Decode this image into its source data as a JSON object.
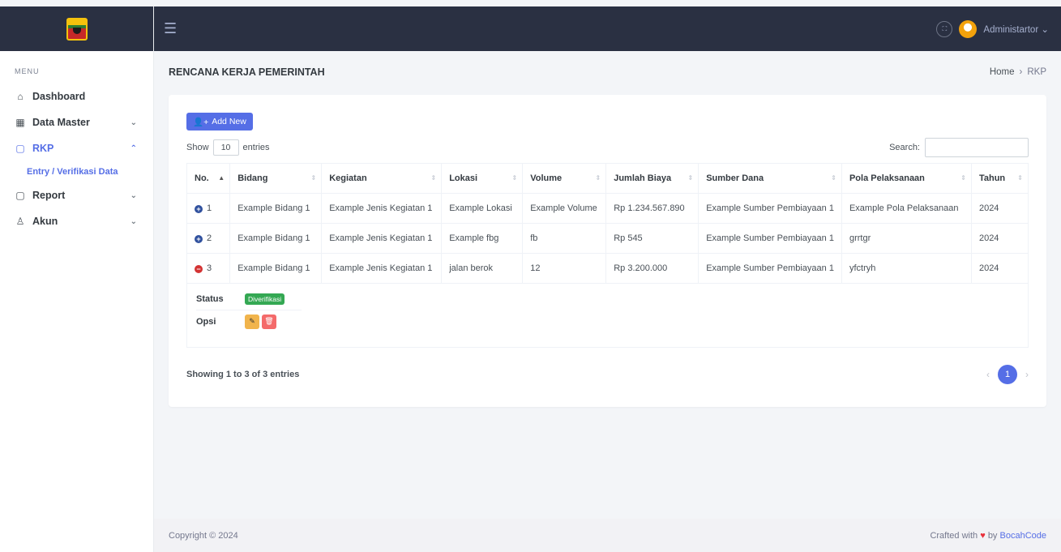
{
  "sidebar": {
    "menu_title": "MENU",
    "items": [
      {
        "label": "Dashboard",
        "icon": "home-icon"
      },
      {
        "label": "Data Master",
        "icon": "grid-icon"
      },
      {
        "label": "RKP",
        "icon": "file-icon"
      },
      {
        "label": "Report",
        "icon": "file-icon"
      },
      {
        "label": "Akun",
        "icon": "users-icon"
      }
    ],
    "subitem": "Entry / Verifikasi Data"
  },
  "topbar": {
    "user_name": "Administartor"
  },
  "page": {
    "title": "RENCANA KERJA PEMERINTAH",
    "breadcrumb_home": "Home",
    "breadcrumb_sep": "›",
    "breadcrumb_current": "RKP"
  },
  "toolbar": {
    "add_label": "Add New",
    "show_label": "Show",
    "length_value": "10",
    "entries_label": "entries",
    "search_label": "Search:"
  },
  "table": {
    "columns": [
      "No.",
      "Bidang",
      "Kegiatan",
      "Lokasi",
      "Volume",
      "Jumlah Biaya",
      "Sumber Dana",
      "Pola Pelaksanaan",
      "Tahun"
    ],
    "rows": [
      [
        "1",
        "Example Bidang 1",
        "Example Jenis Kegiatan 1",
        "Example Lokasi",
        "Example Volume",
        "Rp 1.234.567.890",
        "Example Sumber Pembiayaan 1",
        "Example Pola Pelaksanaan",
        "2024"
      ],
      [
        "2",
        "Example Bidang 1",
        "Example Jenis Kegiatan 1",
        "Example fbg",
        "fb",
        "Rp 545",
        "Example Sumber Pembiayaan 1",
        "grrtgr",
        "2024"
      ],
      [
        "3",
        "Example Bidang 1",
        "Example Jenis Kegiatan 1",
        "jalan berok",
        "12",
        "Rp 3.200.000",
        "Example Sumber Pembiayaan 1",
        "yfctryh",
        "2024"
      ]
    ],
    "child": {
      "status_label": "Status",
      "status_value": "Diverifikasi",
      "opsi_label": "Opsi"
    }
  },
  "footer_info": "Showing 1 to 3 of 3 entries",
  "pagination": {
    "current": "1",
    "prev": "‹",
    "next": "›"
  },
  "footer": {
    "copyright": "Copyright © 2024",
    "crafted": "Crafted with",
    "by": "by",
    "brand": "BocahCode"
  },
  "colors": {
    "primary": "#556ee6",
    "topbar": "#2a3042",
    "success": "#34a853",
    "warning": "#f1b44c",
    "danger": "#f46a6a"
  }
}
